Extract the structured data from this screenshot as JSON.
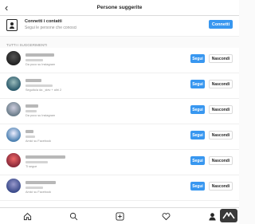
{
  "header": {
    "back_icon": "‹",
    "title": "Persone suggerite"
  },
  "connect": {
    "icon": "contacts-icon",
    "title": "Connetti i contatti",
    "subtitle": "Segui le persone che conosci",
    "button_label": "Connetti"
  },
  "section_label": "TUTTI I SUGGERIMENTI",
  "suggestions": [
    {
      "meta": "Da poco su Instagram",
      "follow_label": "Segui",
      "hide_label": "Nascondi",
      "avatar_color": "#2a2a3a"
    },
    {
      "meta": "Seguito/a da _stev + altri 2",
      "follow_label": "Segui",
      "hide_label": "Nascondi",
      "avatar_color": "#2c5a6b"
    },
    {
      "meta": "Da poco su Instagram",
      "follow_label": "Segui",
      "hide_label": "Nascondi",
      "avatar_color": "#6b7d8a"
    },
    {
      "meta": "Amici su Facebook",
      "follow_label": "Segui",
      "hide_label": "Nascondi",
      "avatar_color": "#4a7fb0"
    },
    {
      "meta": "Ti segue",
      "follow_label": "Segui",
      "hide_label": "Nascondi",
      "avatar_color": "#8a2a3a"
    },
    {
      "meta": "Amici su Facebook",
      "follow_label": "Segui",
      "hide_label": "Nascondi",
      "avatar_color": "#3a4a8a"
    }
  ],
  "tabbar": {
    "items": [
      "home-icon",
      "search-icon",
      "add-post-icon",
      "activity-heart-icon",
      "profile-icon"
    ]
  },
  "watermark": "chimera-logo"
}
